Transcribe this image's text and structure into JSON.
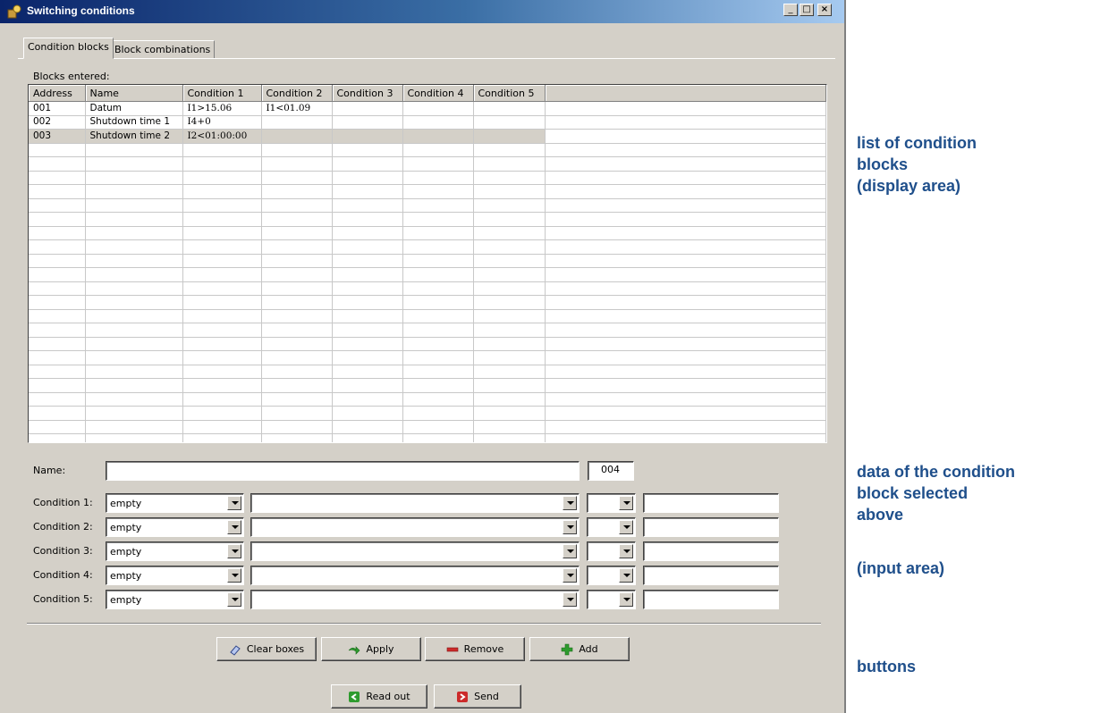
{
  "window": {
    "title": "Switching conditions",
    "buttons": {
      "minimize": "_",
      "maximize": "□",
      "close": "×"
    }
  },
  "tabs": [
    {
      "label": "Condition blocks",
      "active": true
    },
    {
      "label": "Block combinations",
      "active": false
    }
  ],
  "blocks": {
    "label": "Blocks entered:",
    "columns": [
      "Address",
      "Name",
      "Condition 1",
      "Condition 2",
      "Condition 3",
      "Condition 4",
      "Condition 5"
    ],
    "rows": [
      [
        "001",
        "Datum",
        "I1>15.06",
        "I1<01.09",
        "",
        "",
        ""
      ],
      [
        "002",
        "Shutdown time 1",
        "I4+0",
        "",
        "",
        "",
        ""
      ],
      [
        "003",
        "Shutdown time 2",
        "I2<01:00:00",
        "",
        "",
        "",
        ""
      ]
    ],
    "selected_row": 2
  },
  "form": {
    "name_label": "Name:",
    "name_value": "",
    "address_value": "004",
    "conditions": [
      {
        "label": "Condition 1:",
        "type": "empty",
        "operand": "",
        "operator": "",
        "value": ""
      },
      {
        "label": "Condition 2:",
        "type": "empty",
        "operand": "",
        "operator": "",
        "value": ""
      },
      {
        "label": "Condition 3:",
        "type": "empty",
        "operand": "",
        "operator": "",
        "value": ""
      },
      {
        "label": "Condition 4:",
        "type": "empty",
        "operand": "",
        "operator": "",
        "value": ""
      },
      {
        "label": "Condition 5:",
        "type": "empty",
        "operand": "",
        "operator": "",
        "value": ""
      }
    ]
  },
  "buttons": {
    "clear": "Clear boxes",
    "apply": "Apply",
    "remove": "Remove",
    "add": "Add",
    "read_out": "Read out",
    "send": "Send"
  },
  "annotations": {
    "list": [
      "list of condition",
      "blocks",
      "(display area)"
    ],
    "data": [
      "data of the condition",
      "block selected",
      "above"
    ],
    "input": "(input area)",
    "buttons": "buttons"
  },
  "colors": {
    "window_bg": "#d4d0c8",
    "title_bar": "#0a246a",
    "annotation_text": "#1f4f8b",
    "icon_green": "#2e9b2e",
    "icon_red": "#cc2a2a"
  }
}
